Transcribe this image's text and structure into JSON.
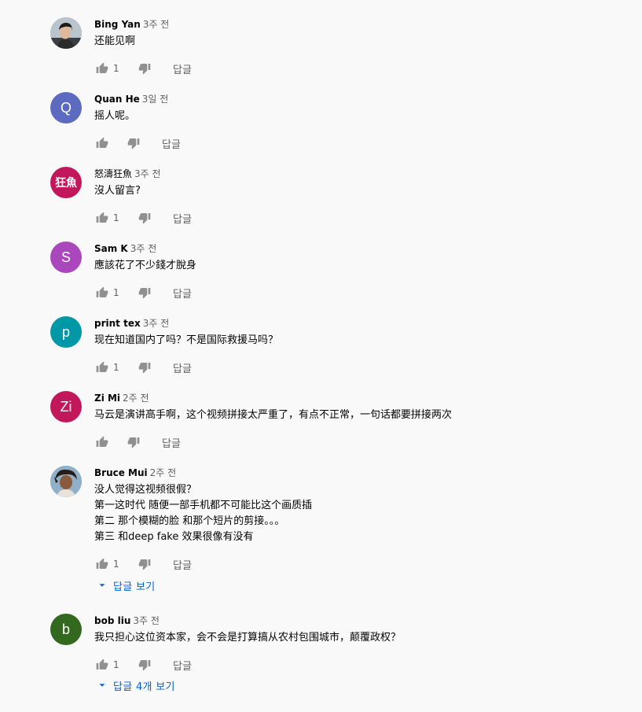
{
  "comments": [
    {
      "author": "Bing Yan",
      "time": "3주 전",
      "avatar_letter": "",
      "avatar_color": "#2a2a2a",
      "lines": [
        "还能见啊"
      ],
      "like_count": "1",
      "reply_label": "답글"
    },
    {
      "author": "Quan He",
      "time": "3일 전",
      "avatar_letter": "Q",
      "avatar_color": "#5c6bc0",
      "lines": [
        "摇人呢。"
      ],
      "like_count": "",
      "reply_label": "답글"
    },
    {
      "author": "怒濤狂魚",
      "time": "3주 전",
      "avatar_letter": "狂魚",
      "avatar_color": "#c2185b",
      "lines": [
        "沒人留言?"
      ],
      "like_count": "1",
      "reply_label": "답글"
    },
    {
      "author": "Sam K",
      "time": "3주 전",
      "avatar_letter": "S",
      "avatar_color": "#ab47bc",
      "lines": [
        "應該花了不少錢才脫身"
      ],
      "like_count": "1",
      "reply_label": "답글"
    },
    {
      "author": "print tex",
      "time": "3주 전",
      "avatar_letter": "p",
      "avatar_color": "#0097a7",
      "lines": [
        "现在知道国内了吗？不是国际救援马吗？"
      ],
      "like_count": "1",
      "reply_label": "답글"
    },
    {
      "author": "Zi Mi",
      "time": "2주 전",
      "avatar_letter": "Zi",
      "avatar_color": "#c2185b",
      "lines": [
        "马云是演讲高手啊，这个视频拼接太严重了，有点不正常，一句话都要拼接两次"
      ],
      "like_count": "",
      "reply_label": "답글"
    },
    {
      "author": "Bruce Mui",
      "time": "2주 전",
      "avatar_letter": "",
      "avatar_color": "#6d8fa6",
      "lines": [
        "没人觉得这视频很假？",
        "第一这时代 随便一部手机都不可能比这个画质插",
        "第二 那个模糊的脸 和那个短片的剪接。。。",
        "第三 和deep fake 效果很像有没有"
      ],
      "like_count": "1",
      "reply_label": "답글",
      "view_replies": "답글 보기"
    },
    {
      "author": "bob liu",
      "time": "3주 전",
      "avatar_letter": "b",
      "avatar_color": "#33691e",
      "lines": [
        "我只担心这位资本家，会不会是打算搞从农村包围城市，颠覆政权？"
      ],
      "like_count": "1",
      "reply_label": "답글",
      "view_replies": "답글 4개 보기"
    }
  ]
}
